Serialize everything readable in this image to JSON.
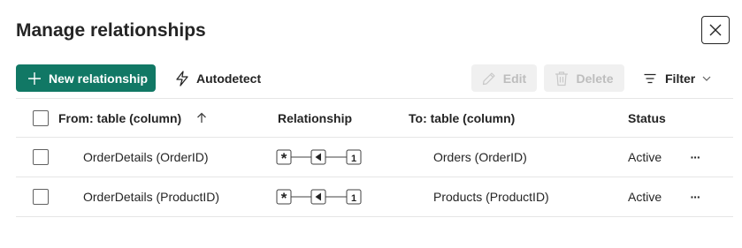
{
  "dialog": {
    "title": "Manage relationships"
  },
  "toolbar": {
    "new_relationship_label": "New relationship",
    "autodetect_label": "Autodetect",
    "edit_label": "Edit",
    "delete_label": "Delete",
    "filter_label": "Filter"
  },
  "table": {
    "columns": {
      "from": "From: table (column)",
      "relationship": "Relationship",
      "to": "To: table (column)",
      "status": "Status"
    },
    "rows": [
      {
        "from": "OrderDetails (OrderID)",
        "cardinality_many": "*",
        "cardinality_one": "1",
        "to": "Orders (OrderID)",
        "status": "Active",
        "more": "···"
      },
      {
        "from": "OrderDetails (ProductID)",
        "cardinality_many": "*",
        "cardinality_one": "1",
        "to": "Products (ProductID)",
        "status": "Active",
        "more": "···"
      }
    ]
  },
  "colors": {
    "primary": "#117865",
    "disabled_bg": "#f0f0f0",
    "disabled_text": "#bdbdbd"
  },
  "icons": [
    "close-icon",
    "plus-icon",
    "lightning-icon",
    "pencil-icon",
    "trash-icon",
    "filter-icon",
    "chevron-down-icon",
    "arrow-up-icon",
    "more-icon"
  ]
}
